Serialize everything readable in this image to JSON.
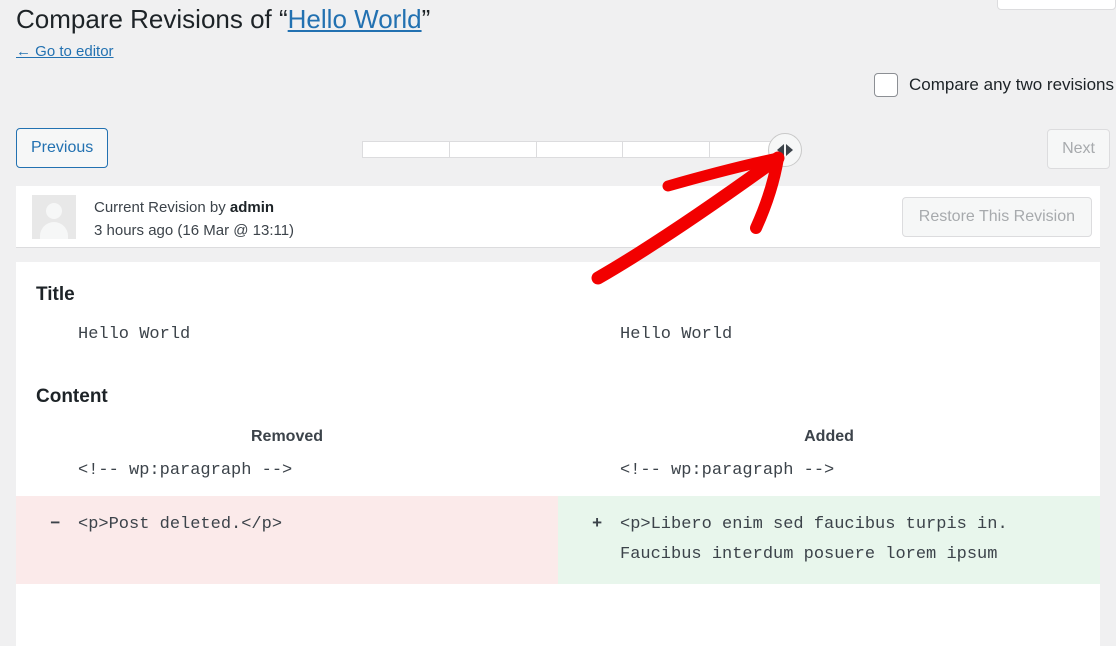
{
  "header": {
    "title_prefix": "Compare Revisions of “",
    "post_title": "Hello World",
    "title_suffix": "”",
    "back_link": "← Go to editor"
  },
  "compare_toggle": {
    "label": "Compare any two revisions",
    "checked": false
  },
  "controls": {
    "previous_label": "Previous",
    "next_label": "Next",
    "next_disabled": true,
    "slider": {
      "segments": 5,
      "handle_position": "right",
      "handle_icon": "left-right-arrows-icon"
    }
  },
  "revision": {
    "by_text": "Current Revision by ",
    "author": "admin",
    "timestamp": "3 hours ago (16 Mar @ 13:11)",
    "restore_label": "Restore This Revision",
    "restore_disabled": true,
    "avatar_icon": "user-avatar-placeholder"
  },
  "diff": {
    "title_section": {
      "heading": "Title",
      "left": "Hello World",
      "right": "Hello World"
    },
    "content_section": {
      "heading": "Content",
      "col_removed": "Removed",
      "col_added": "Added",
      "unchanged_left": "<!-- wp:paragraph -->",
      "unchanged_right": "<!-- wp:paragraph -->",
      "removed_sign": "−",
      "removed_text": "<p>Post deleted.</p>",
      "added_sign": "+",
      "added_line1": "<p>Libero enim sed faucibus turpis in.",
      "added_line2": "Faucibus interdum posuere lorem ipsum"
    }
  },
  "colors": {
    "link": "#2271b1",
    "removed_bg": "#fbeaea",
    "added_bg": "#e8f6ec",
    "annotation": "#f20000",
    "page_bg": "#f0f0f1"
  }
}
